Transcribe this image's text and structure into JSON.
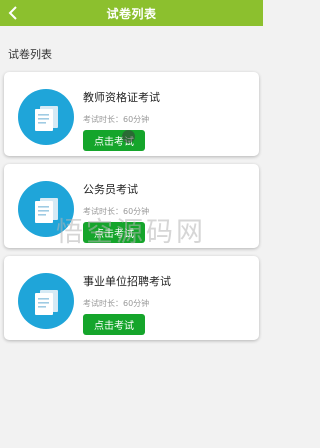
{
  "header": {
    "title": "试卷列表"
  },
  "section": {
    "title": "试卷列表"
  },
  "exams": [
    {
      "title": "教师资格证考试",
      "meta": "考试时长：60分钟",
      "button_label": "点击考试"
    },
    {
      "title": "公务员考试",
      "meta": "考试时长：60分钟",
      "button_label": "点击考试"
    },
    {
      "title": "事业单位招聘考试",
      "meta": "考试时长：60分钟",
      "button_label": "点击考试"
    }
  ],
  "watermark": "悟空源码网",
  "colors": {
    "header_bg": "#8cc02e",
    "icon_bg": "#1fa5d9",
    "button_bg": "#15a52b"
  }
}
